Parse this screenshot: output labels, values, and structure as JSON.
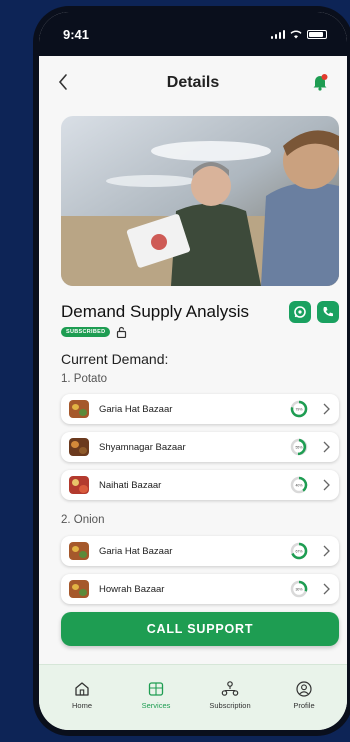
{
  "status_bar": {
    "time": "9:41"
  },
  "header": {
    "title": "Details",
    "back_icon": "chevron-left-icon",
    "bell_icon": "bell-icon"
  },
  "service": {
    "title": "Demand Supply Analysis",
    "badge": "SUBSCRIBED",
    "lock_icon": "lock-open-icon",
    "actions": [
      "whatsapp-icon",
      "phone-icon"
    ]
  },
  "demand": {
    "heading": "Current Demand:",
    "groups": [
      {
        "label": "1. Potato",
        "markets": [
          {
            "name": "Garia Hat Bazaar",
            "percent": "79%"
          },
          {
            "name": "Shyamnagar Bazaar",
            "percent": "55%"
          },
          {
            "name": "Naihati Bazaar",
            "percent": "40%"
          }
        ]
      },
      {
        "label": "2. Onion",
        "markets": [
          {
            "name": "Garia Hat Bazaar",
            "percent": "67%"
          },
          {
            "name": "Howrah Bazaar",
            "percent": "30%"
          }
        ]
      }
    ]
  },
  "call_support": {
    "label": "CALL SUPPORT"
  },
  "nav": {
    "items": [
      {
        "label": "Home",
        "icon": "home-icon"
      },
      {
        "label": "Services",
        "icon": "services-icon",
        "active": true
      },
      {
        "label": "Subscription",
        "icon": "subscription-icon"
      },
      {
        "label": "Profile",
        "icon": "profile-icon"
      }
    ]
  },
  "colors": {
    "primary": "#1e9d52",
    "background": "#0d2456",
    "nav_bg": "#e9f3ea"
  }
}
